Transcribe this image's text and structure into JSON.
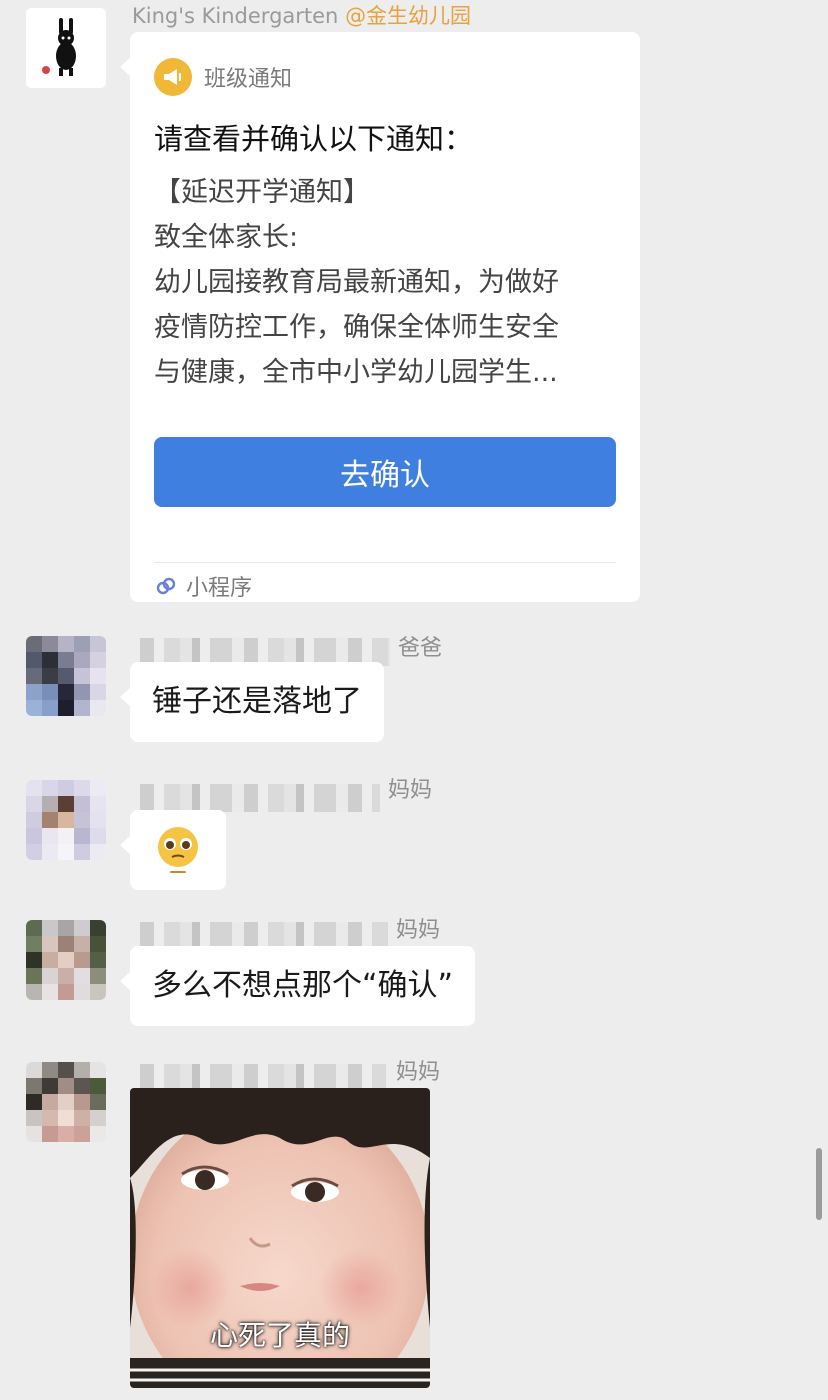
{
  "message1": {
    "sender": "King's Kindergarten",
    "org": "@金生幼儿园",
    "card": {
      "app_name": "班级通知",
      "title": "请查看并确认以下通知：",
      "body_lines": [
        "【延迟开学通知】",
        "致全体家长:",
        "幼儿园接教育局最新通知，为做好",
        "疫情防控工作，确保全体师生安全",
        "与健康，全市中小学幼儿园学生..."
      ],
      "button_label": "去确认",
      "footer": "小程序",
      "icon": "megaphone-icon",
      "accent": "#3f7fe0"
    }
  },
  "message2": {
    "role": "爸爸",
    "text": "锤子还是落地了"
  },
  "message3": {
    "role": "妈妈",
    "emoji": "pleading-face-emoji"
  },
  "message4": {
    "role": "妈妈",
    "text": "多么不想点那个“确认”"
  },
  "message5": {
    "role": "妈妈",
    "image_caption": "心死了真的"
  }
}
